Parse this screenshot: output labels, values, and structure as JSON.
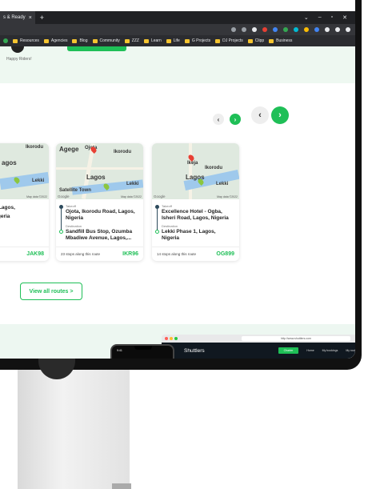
{
  "browser": {
    "tab_title": "s & Ready",
    "tab_close": "×",
    "new_tab": "+",
    "window_controls": [
      "⌄",
      "–",
      "▫",
      "✕"
    ],
    "bookmarks": [
      "Resources",
      "Agencies",
      "Blog",
      "Community",
      "ZZZ",
      "Learn",
      "Life",
      "G Projects",
      "DJ Projects",
      "Clipp",
      "Business"
    ]
  },
  "page": {
    "happy_riders": "Happy Riders!",
    "view_all": "View all routes >"
  },
  "carousel": {
    "prev_small": "‹",
    "next_small": "›",
    "prev_big": "‹",
    "next_big": "›"
  },
  "cards": [
    {
      "map": {
        "labels": [
          "Ikorodu",
          "agos",
          "Lekki"
        ],
        "map_data": "Map data ©2022"
      },
      "takeoff_tag": "",
      "takeoff": "Bus Stop., Lagos,",
      "destination_tag": "",
      "destination": ", Lagos, Nigeria",
      "stops": "oute",
      "code": "JAK98"
    },
    {
      "map": {
        "labels": [
          "Agege",
          "Ojota",
          "Ikorodu",
          "Lagos",
          "Satellite Town",
          "Lekki",
          "Google"
        ],
        "map_data": "Map data ©2022"
      },
      "takeoff_tag": "Takeoff",
      "takeoff": "Ojota, Ikorodu Road, Lagos, Nigeria",
      "destination_tag": "Destination",
      "destination": "Sandfill Bus Stop, Ozumba Mbadiwe Avenue, Lagos,...",
      "stops": "23 stops along this route",
      "code": "IKR96"
    },
    {
      "map": {
        "labels": [
          "Ikeja",
          "Ikorodu",
          "Lagos",
          "Lekki",
          "Google"
        ],
        "map_data": "Map data ©2022"
      },
      "takeoff_tag": "Takeoff",
      "takeoff": "Excellence Hotel - Ogba, Isheri Road, Lagos, Nigeria",
      "destination_tag": "Destination",
      "destination": "Lekki Phase 1, Lagos, Nigeria",
      "stops": "14 stops along this route",
      "code": "OG899"
    }
  ],
  "mini_site": {
    "url": "http://www.shuttlers.com",
    "logo": "Shuttlers",
    "cta": "Charter",
    "links": [
      "Home",
      "My bookings",
      "My rout"
    ],
    "phone_time": "9:41"
  },
  "colors": {
    "accent": "#1fbf57",
    "dark": "#101820"
  }
}
